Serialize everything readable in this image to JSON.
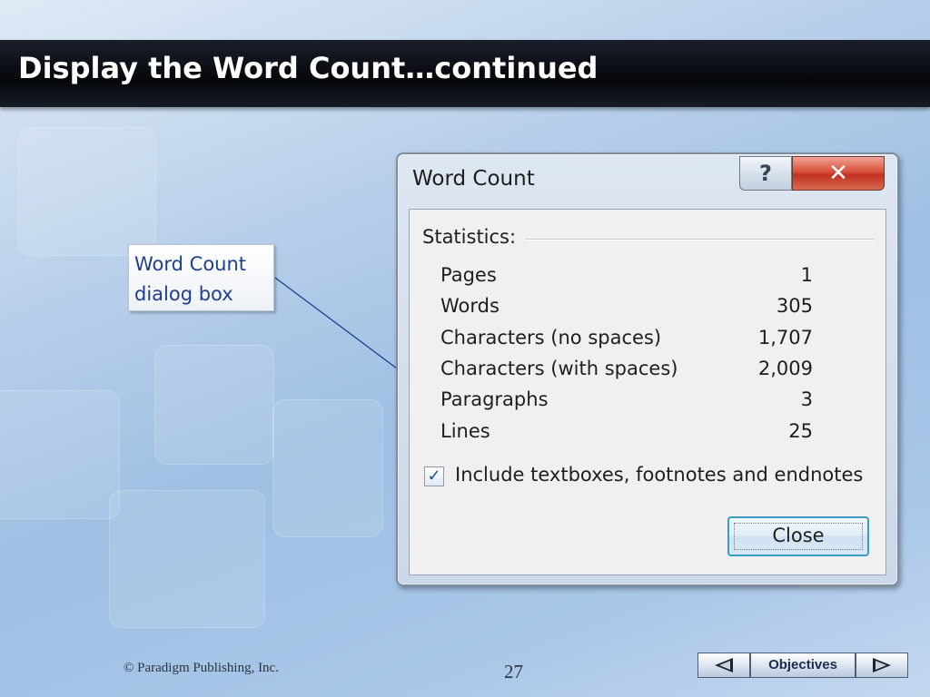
{
  "slide": {
    "title": "Display the Word Count…continued",
    "callout": {
      "line1": "Word Count",
      "line2": "dialog box"
    },
    "footer": {
      "copyright": "© Paradigm Publishing, Inc.",
      "page_number": "27"
    },
    "nav": {
      "objectives_label": "Objectives",
      "prev_icon": "left-arrow-icon",
      "next_icon": "right-arrow-icon"
    }
  },
  "dialog": {
    "title": "Word Count",
    "help_label": "?",
    "close_x_label": "✕",
    "section_label": "Statistics:",
    "stats": [
      {
        "label": "Pages",
        "value": "1"
      },
      {
        "label": "Words",
        "value": "305"
      },
      {
        "label": "Characters (no spaces)",
        "value": "1,707"
      },
      {
        "label": "Characters (with spaces)",
        "value": "2,009"
      },
      {
        "label": "Paragraphs",
        "value": "3"
      },
      {
        "label": "Lines",
        "value": "25"
      }
    ],
    "checkbox": {
      "label": "Include textboxes, footnotes and endnotes",
      "checked": true,
      "mark": "✓"
    },
    "close_button_label": "Close"
  },
  "colors": {
    "title_bar": "#05070b",
    "callout_text": "#1f3e8f",
    "close_x_red": "#c13222",
    "button_focus": "#3a9bc5"
  }
}
